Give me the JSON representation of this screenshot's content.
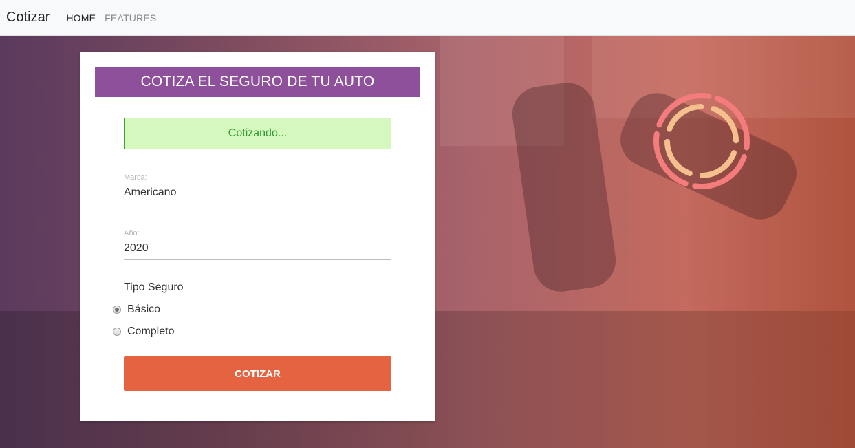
{
  "navbar": {
    "brand": "Cotizar",
    "links": [
      {
        "label": "HOME"
      },
      {
        "label": "FEATURES"
      }
    ]
  },
  "card": {
    "title": "COTIZA EL SEGURO DE TU AUTO",
    "status": "Cotizando...",
    "marca": {
      "label": "Marca:",
      "value": "Americano"
    },
    "anio": {
      "label": "Año:",
      "value": "2020"
    },
    "tipo_seguro": {
      "label": "Tipo Seguro",
      "options": [
        {
          "label": "Básico",
          "checked": true
        },
        {
          "label": "Completo",
          "checked": false
        }
      ]
    },
    "submit_label": "COTIZAR"
  },
  "colors": {
    "header_bg": "#8e4f9b",
    "status_bg": "#d4f8bd",
    "status_text": "#2f9a32",
    "button_bg": "#e66342",
    "spinner_outer": "#f47c7c",
    "spinner_inner": "#f5c08e"
  },
  "icons": {
    "spinner": "loading-spinner-icon"
  }
}
